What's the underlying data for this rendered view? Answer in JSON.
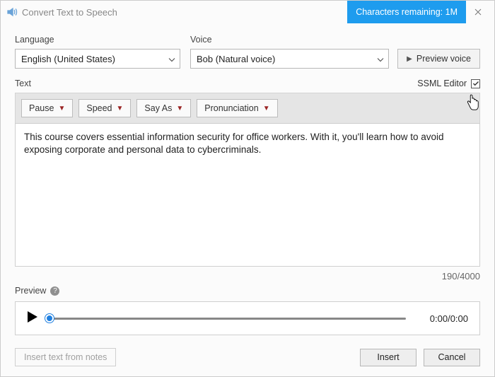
{
  "titlebar": {
    "title": "Convert Text to Speech",
    "chars_remaining": "Characters remaining: 1M"
  },
  "labels": {
    "language": "Language",
    "voice": "Voice",
    "text": "Text",
    "ssml_editor": "SSML Editor",
    "preview": "Preview"
  },
  "language_select": {
    "value": "English (United States)"
  },
  "voice_select": {
    "value": "Bob (Natural voice)"
  },
  "buttons": {
    "preview_voice": "Preview voice",
    "insert_from_notes": "Insert text from notes",
    "insert": "Insert",
    "cancel": "Cancel"
  },
  "toolbar": {
    "pause": "Pause",
    "speed": "Speed",
    "say_as": "Say As",
    "pronunciation": "Pronunciation"
  },
  "text_content": "This course covers essential information security for office workers. With it, you'll learn how to avoid exposing corporate and personal data to cybercriminals.",
  "counter": "190/4000",
  "player": {
    "time": "0:00/0:00"
  },
  "ssml_checked": true
}
